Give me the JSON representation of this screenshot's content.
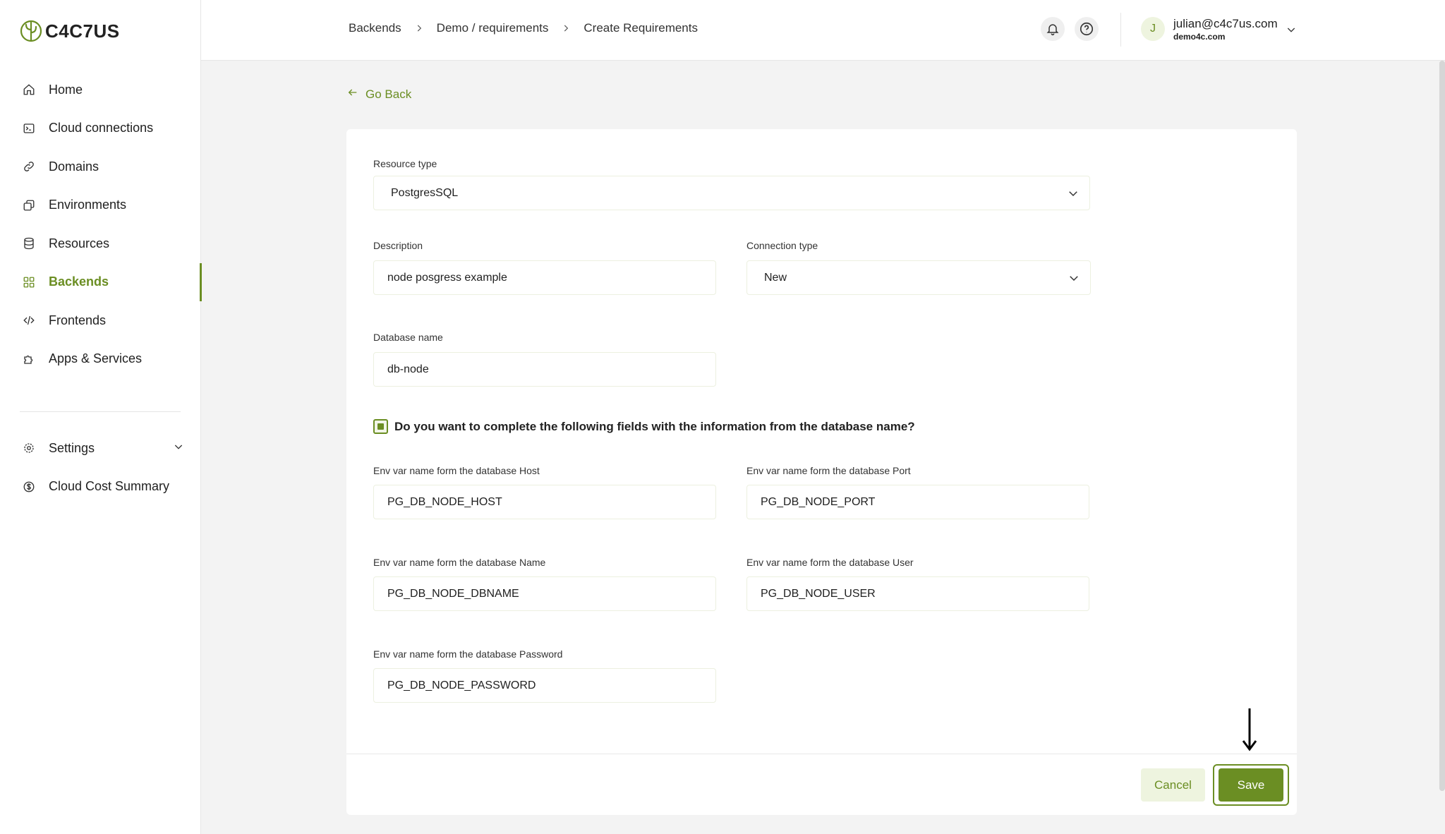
{
  "brand": {
    "name": "C4C7US",
    "accent": "#6b8e23"
  },
  "sidebar": {
    "items": [
      {
        "label": "Home",
        "icon": "home-icon"
      },
      {
        "label": "Cloud connections",
        "icon": "terminal-icon"
      },
      {
        "label": "Domains",
        "icon": "link-icon"
      },
      {
        "label": "Environments",
        "icon": "environments-icon"
      },
      {
        "label": "Resources",
        "icon": "database-icon"
      },
      {
        "label": "Backends",
        "icon": "grid-icon",
        "active": true
      },
      {
        "label": "Frontends",
        "icon": "code-icon"
      },
      {
        "label": "Apps & Services",
        "icon": "puzzle-icon"
      }
    ],
    "settings": {
      "label": "Settings",
      "icon": "gear-icon"
    },
    "cost": {
      "label": "Cloud Cost Summary",
      "icon": "dollar-icon"
    }
  },
  "header": {
    "breadcrumbs": [
      "Backends",
      "Demo / requirements",
      "Create Requirements"
    ],
    "user": {
      "initial": "J",
      "email": "julian@c4c7us.com",
      "org": "demo4c.com"
    }
  },
  "main": {
    "go_back": "Go Back",
    "resource_type": {
      "label": "Resource type",
      "value": "PostgresSQL"
    },
    "description": {
      "label": "Description",
      "value": "node posgress example"
    },
    "connection_type": {
      "label": "Connection type",
      "value": "New"
    },
    "database_name": {
      "label": "Database name",
      "value": "db-node"
    },
    "autocomplete": {
      "label": "Do you want to complete the following fields with the information from the database name?",
      "checked": true
    },
    "env_host": {
      "label": "Env var name form the database Host",
      "value": "PG_DB_NODE_HOST"
    },
    "env_port": {
      "label": "Env var name form the database Port",
      "value": "PG_DB_NODE_PORT"
    },
    "env_name": {
      "label": "Env var name form the database Name",
      "value": "PG_DB_NODE_DBNAME"
    },
    "env_user": {
      "label": "Env var name form the database User",
      "value": "PG_DB_NODE_USER"
    },
    "env_password": {
      "label": "Env var name form the database Password",
      "value": "PG_DB_NODE_PASSWORD"
    },
    "cancel_label": "Cancel",
    "save_label": "Save"
  }
}
